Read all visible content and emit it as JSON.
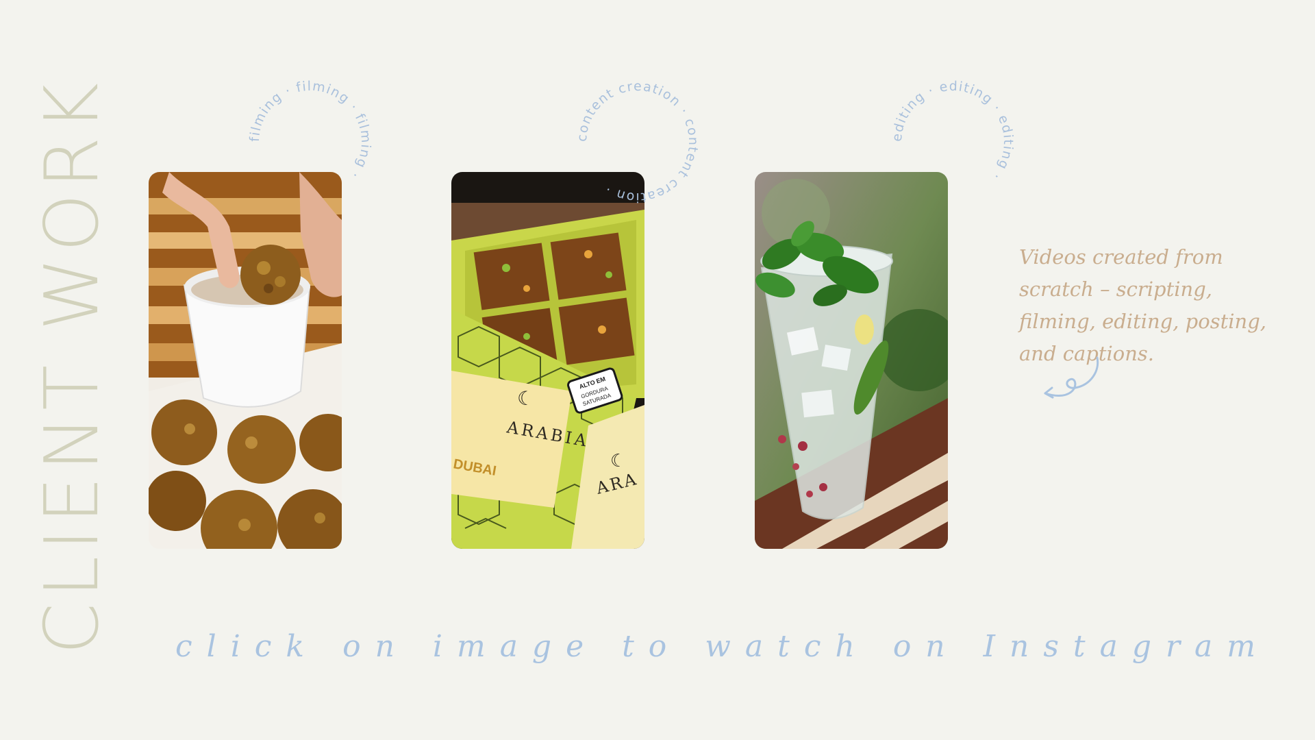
{
  "title": "CLIENT WORK",
  "cards": [
    {
      "ring_label": "filming",
      "image": "falafel-dipping-sauce-photo"
    },
    {
      "ring_label": "content creation",
      "image": "arabia-chocolate-box-photo"
    },
    {
      "ring_label": "editing",
      "image": "mint-mojito-glass-photo"
    }
  ],
  "arabia_box": {
    "brand": "ARABIA",
    "flavor": "DUBAI",
    "second_brand_partial": "ARA",
    "warning_line1": "ALTO EM",
    "warning_line2": "GORDURA",
    "warning_line3": "SATURADA"
  },
  "description": "Videos created from scratch – scripting, filming, editing, posting, and captions.",
  "cta": "click on image to watch on Instagram",
  "colors": {
    "background": "#f3f3ee",
    "title": "#d2d2bc",
    "accent_blue": "#a9c3e0",
    "accent_tan": "#c9ad8e"
  }
}
